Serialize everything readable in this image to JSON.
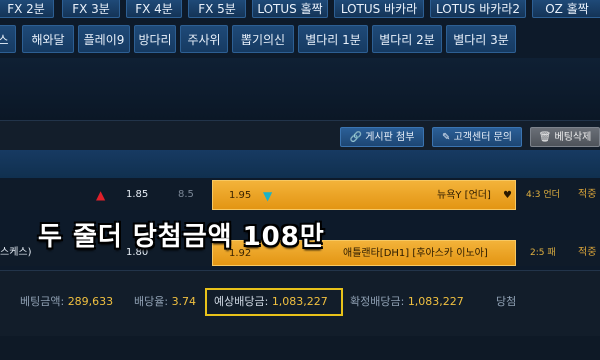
{
  "top_tabs": [
    "FX 2분",
    "FX 3분",
    "FX 4분",
    "FX 5분",
    "LOTUS 홀짝",
    "LOTUS 바카라",
    "LOTUS 바카라2",
    "OZ 홀짝"
  ],
  "nav_tabs": [
    "스",
    "해와달",
    "플레이9",
    "방다리",
    "주사위",
    "뽑기의신",
    "별다리 1분",
    "별다리 2분",
    "별다리 3분"
  ],
  "toolbar": {
    "board_attach": "게시판 첨부",
    "support_inquiry": "고객센터 문의",
    "delete_bet": "베팅삭제"
  },
  "match1": {
    "home_odds": "1.85",
    "draw_odds": "8.5",
    "away_odds": "1.95",
    "team": "뉴욕Y [언더]",
    "score": "4:3 언더",
    "result": "적중"
  },
  "match2": {
    "left_team": "스케스)",
    "home_odds": "1.80",
    "away_odds": "1.92",
    "team": "애틀랜타[DH1] [후아스카 이노아]",
    "score": "2:5 패",
    "result": "적중"
  },
  "banner": "두 줄더 당첨금액 108만",
  "summary": {
    "bet_amount_label": "베팅금액: ",
    "bet_amount": "289,633",
    "odds_label": "배당율: ",
    "odds": "3.74",
    "expected_label": "예상배당금: ",
    "expected": "1,083,227",
    "confirmed_label": "확정배당금: ",
    "confirmed": "1,083,227",
    "status": "당첨"
  },
  "colors": {
    "accent_gold": "#f0a927",
    "highlight_border": "#e8c21a",
    "up_red": "#e0202a",
    "down_teal": "#1bb3c7"
  }
}
